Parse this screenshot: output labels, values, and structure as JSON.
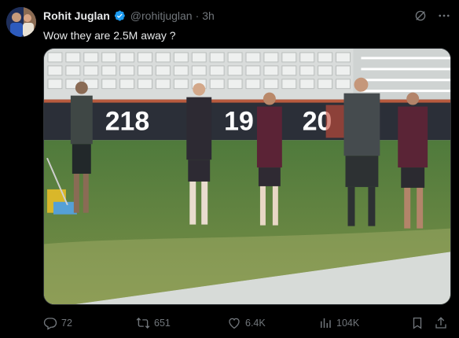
{
  "tweet": {
    "author_name": "Rohit Juglan",
    "handle": "@rohitjuglan",
    "separator": "·",
    "time": "3h",
    "text": "Wow they are 2.5M away ?",
    "verified_color": "#1d9bf0",
    "icons": {
      "verified": "verified-badge-icon",
      "grok": "grok-icon",
      "more": "more-icon"
    }
  },
  "media": {
    "board_text_1": "218",
    "board_text_2": "19",
    "board_text_3": "20"
  },
  "actions": {
    "reply_count": "72",
    "retweet_count": "651",
    "like_count": "6.4K",
    "views_count": "104K",
    "icons": [
      "reply-icon",
      "retweet-icon",
      "like-icon",
      "views-icon",
      "bookmark-icon",
      "share-icon"
    ]
  },
  "colors": {
    "background": "#000000",
    "text_primary": "#e7e9ea",
    "text_secondary": "#71767b",
    "border": "#2f3336"
  }
}
